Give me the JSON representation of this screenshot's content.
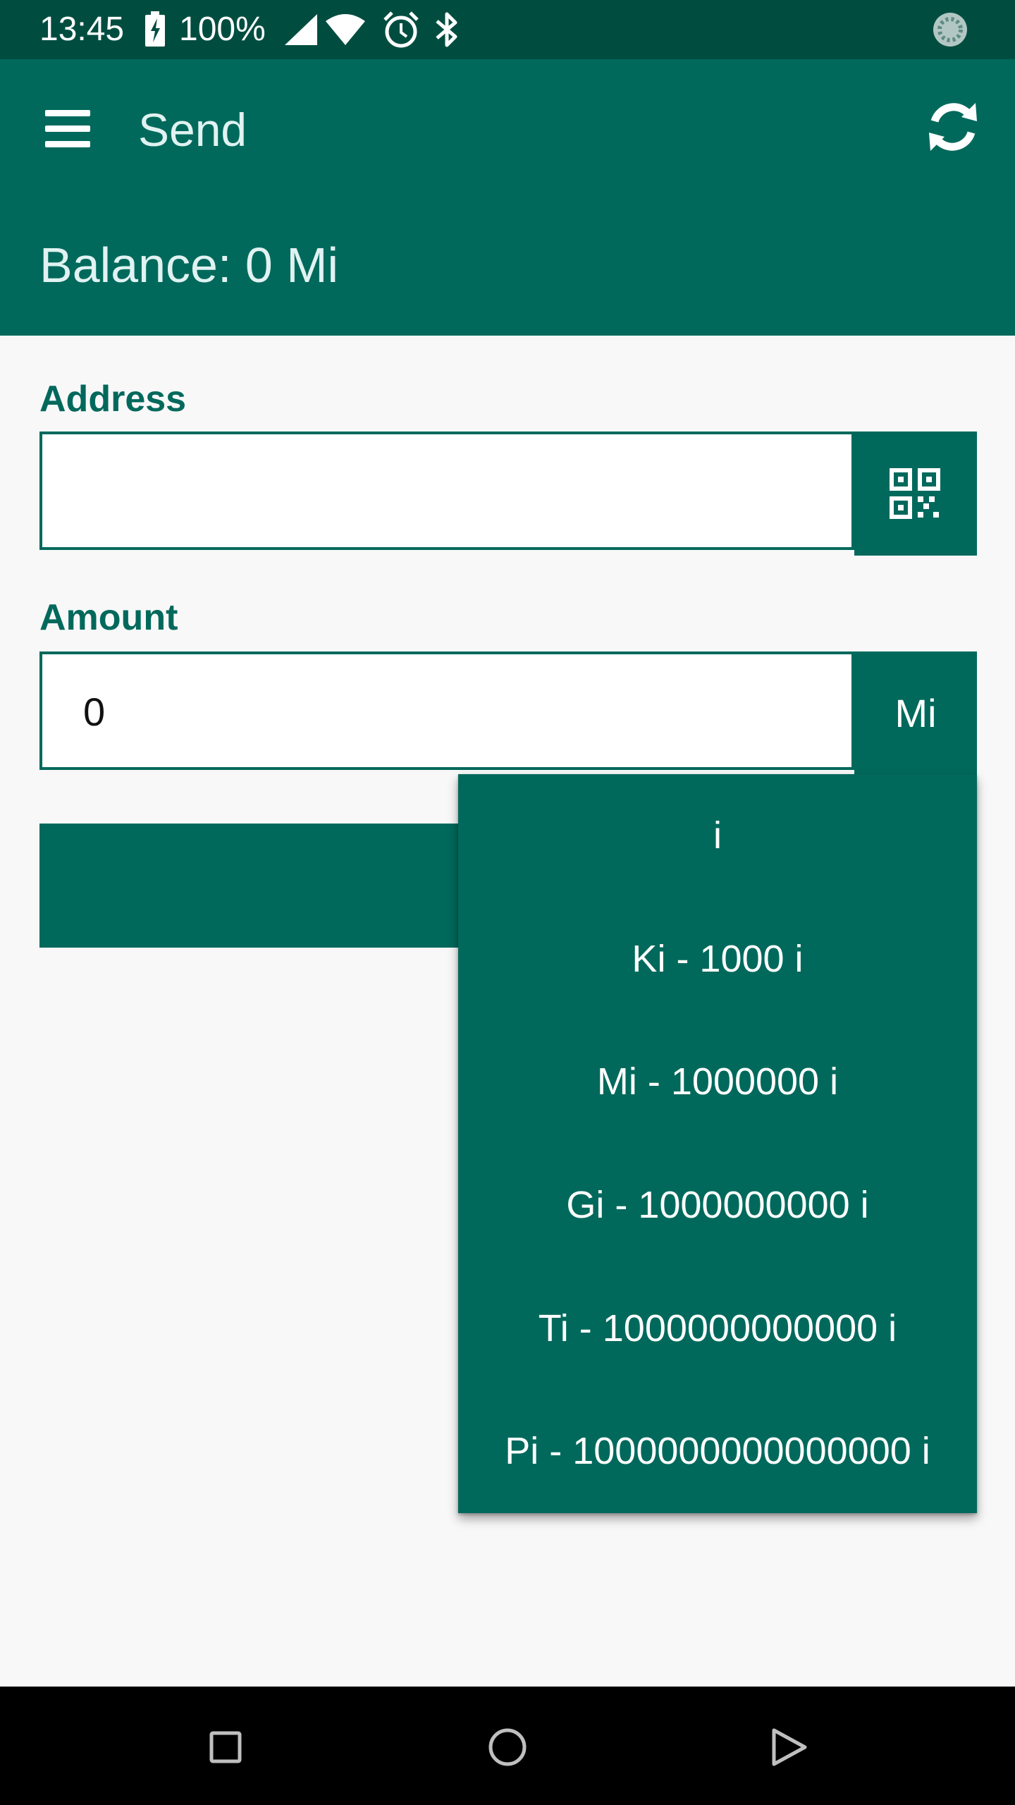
{
  "status_bar": {
    "time": "13:45",
    "battery": "100%",
    "icons": [
      "battery-charging-icon",
      "signal-icon",
      "wifi-icon",
      "alarm-icon",
      "bluetooth-icon",
      "sync-icon"
    ]
  },
  "app_bar": {
    "title": "Send",
    "balance": "Balance: 0 Mi",
    "icons": [
      "menu-icon",
      "refresh-icon"
    ]
  },
  "form": {
    "address_label": "Address",
    "address_value": "",
    "amount_label": "Amount",
    "amount_value": "0",
    "unit": "Mi",
    "qr_icon": "qr-code-icon"
  },
  "dropdown": {
    "items": [
      "i",
      "Ki - 1000 i",
      "Mi - 1000000 i",
      "Gi - 1000000000 i",
      "Ti - 1000000000000 i",
      "Pi - 1000000000000000 i"
    ]
  },
  "nav_bar": {
    "icons": [
      "recents-icon",
      "home-icon",
      "back-icon"
    ]
  },
  "colors": {
    "status_bar": "#004d40",
    "primary": "#00695c",
    "background": "#f8f8f8"
  }
}
